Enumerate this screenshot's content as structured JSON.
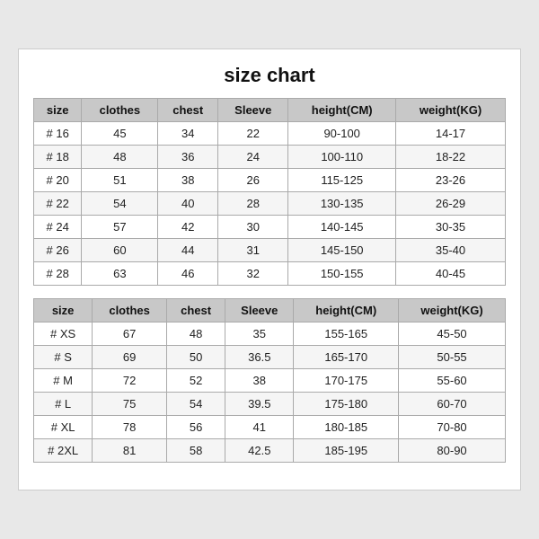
{
  "title": "size chart",
  "tables": [
    {
      "headers": [
        "size",
        "clothes",
        "chest",
        "Sleeve",
        "height(CM)",
        "weight(KG)"
      ],
      "rows": [
        [
          "# 16",
          "45",
          "34",
          "22",
          "90-100",
          "14-17"
        ],
        [
          "# 18",
          "48",
          "36",
          "24",
          "100-110",
          "18-22"
        ],
        [
          "# 20",
          "51",
          "38",
          "26",
          "115-125",
          "23-26"
        ],
        [
          "# 22",
          "54",
          "40",
          "28",
          "130-135",
          "26-29"
        ],
        [
          "# 24",
          "57",
          "42",
          "30",
          "140-145",
          "30-35"
        ],
        [
          "# 26",
          "60",
          "44",
          "31",
          "145-150",
          "35-40"
        ],
        [
          "# 28",
          "63",
          "46",
          "32",
          "150-155",
          "40-45"
        ]
      ]
    },
    {
      "headers": [
        "size",
        "clothes",
        "chest",
        "Sleeve",
        "height(CM)",
        "weight(KG)"
      ],
      "rows": [
        [
          "# XS",
          "67",
          "48",
          "35",
          "155-165",
          "45-50"
        ],
        [
          "# S",
          "69",
          "50",
          "36.5",
          "165-170",
          "50-55"
        ],
        [
          "# M",
          "72",
          "52",
          "38",
          "170-175",
          "55-60"
        ],
        [
          "# L",
          "75",
          "54",
          "39.5",
          "175-180",
          "60-70"
        ],
        [
          "# XL",
          "78",
          "56",
          "41",
          "180-185",
          "70-80"
        ],
        [
          "# 2XL",
          "81",
          "58",
          "42.5",
          "185-195",
          "80-90"
        ]
      ]
    }
  ]
}
